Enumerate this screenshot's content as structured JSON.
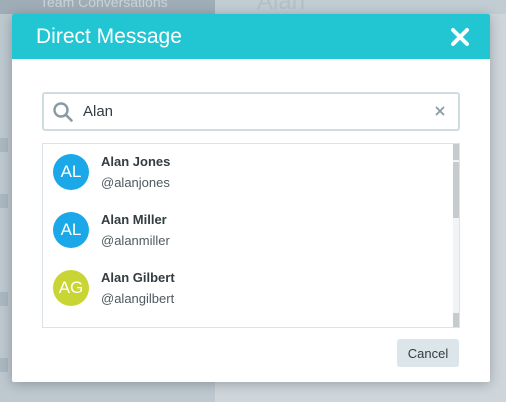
{
  "background": {
    "left_panel_title": "Team Conversations",
    "right_panel_title": "Alan"
  },
  "modal": {
    "title": "Direct Message",
    "close_icon": "close-icon",
    "header_color": "#22c6d3"
  },
  "search": {
    "value": "Alan",
    "icon": "search-icon",
    "clear_icon": "clear-icon"
  },
  "results": [
    {
      "initials": "AL",
      "name": "Alan Jones",
      "handle": "@alanjones",
      "avatar_color": "#1aa8e8"
    },
    {
      "initials": "AL",
      "name": "Alan Miller",
      "handle": "@alanmiller",
      "avatar_color": "#1aa8e8"
    },
    {
      "initials": "AG",
      "name": "Alan Gilbert",
      "handle": "@alangilbert",
      "avatar_color": "#c8d535"
    }
  ],
  "footer": {
    "cancel_label": "Cancel"
  }
}
